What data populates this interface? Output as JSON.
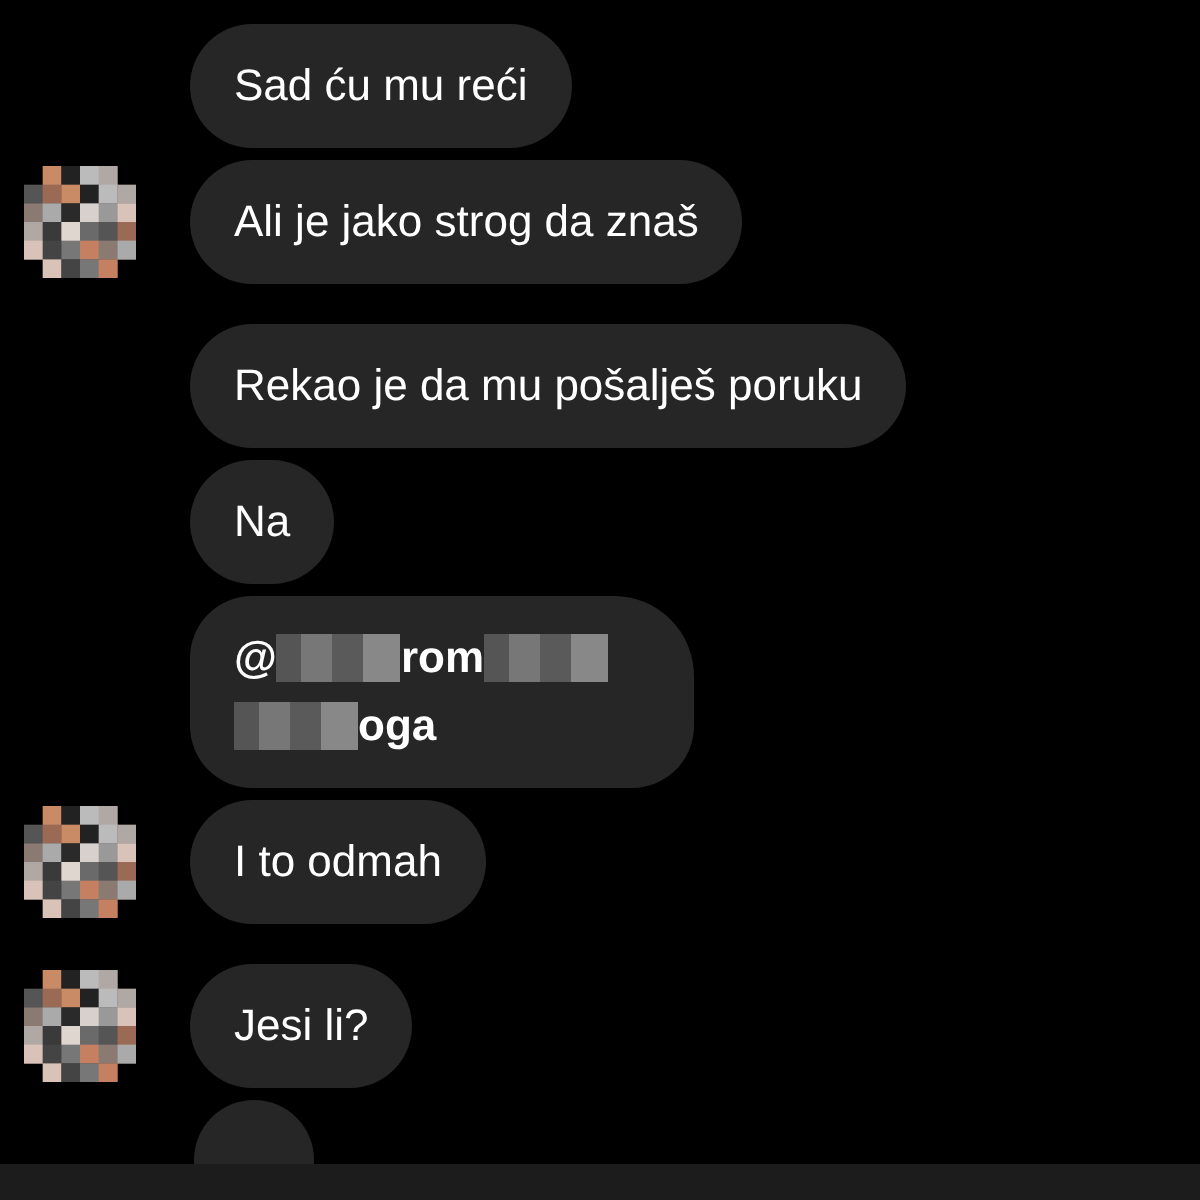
{
  "groups": [
    {
      "messages": [
        {
          "kind": "text",
          "text": "Sad ću mu reći",
          "avatar": false
        },
        {
          "kind": "text",
          "text": "Ali je jako strog da znaš",
          "avatar": true
        }
      ]
    },
    {
      "messages": [
        {
          "kind": "text",
          "text": "Rekao je da mu pošalješ poruku",
          "avatar": false
        },
        {
          "kind": "text",
          "text": "Na",
          "avatar": false
        },
        {
          "kind": "mention",
          "lines": [
            [
              {
                "kind": "text",
                "text": "@"
              },
              {
                "kind": "redacted"
              },
              {
                "kind": "text",
                "text": "rom"
              },
              {
                "kind": "redacted"
              }
            ],
            [
              {
                "kind": "redacted"
              },
              {
                "kind": "text",
                "text": "oga"
              }
            ]
          ],
          "avatar": false
        },
        {
          "kind": "text",
          "text": "I to odmah",
          "avatar": true
        }
      ]
    },
    {
      "messages": [
        {
          "kind": "text",
          "text": "Jesi li?",
          "avatar": true
        },
        {
          "kind": "cut",
          "avatar": false
        }
      ]
    }
  ]
}
